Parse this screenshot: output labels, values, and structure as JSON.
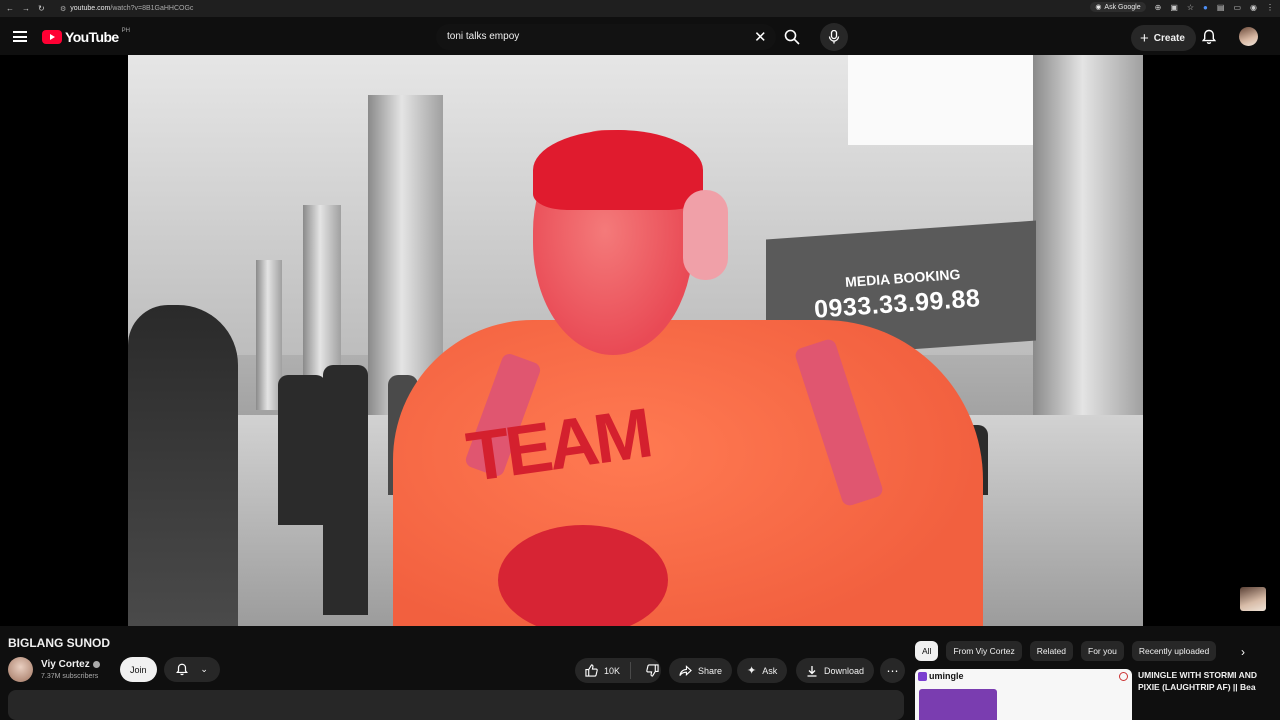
{
  "browser": {
    "url_host": "youtube.com",
    "url_path": "/watch?v=8B1GaHHCOGc",
    "ask_google_label": "Ask Google"
  },
  "header": {
    "logo_text": "YouTube",
    "region": "PH",
    "search_query": "toni talks empoy",
    "create_label": "Create"
  },
  "video": {
    "sign_title": "MEDIA BOOKING",
    "sign_number": "0933.33.99.88",
    "shirt_text": "TEAM"
  },
  "details": {
    "title": "BIGLANG SUNOD",
    "channel_name": "Viy Cortez",
    "subscribers": "7.37M subscribers",
    "join_label": "Join",
    "like_count": "10K",
    "share_label": "Share",
    "ask_label": "Ask",
    "download_label": "Download"
  },
  "recommendations": {
    "chips": [
      "All",
      "From Viy Cortez",
      "Related",
      "For you",
      "Recently uploaded"
    ],
    "active_chip": "All",
    "first_item": {
      "brand": "umingle",
      "title": "UMINGLE WITH STORMI AND PIXIE (LAUGHTRIP AF) || Bea"
    }
  },
  "colors": {
    "background": "#0f0f0f",
    "brand_red": "#ff0033",
    "surface": "#272727"
  }
}
